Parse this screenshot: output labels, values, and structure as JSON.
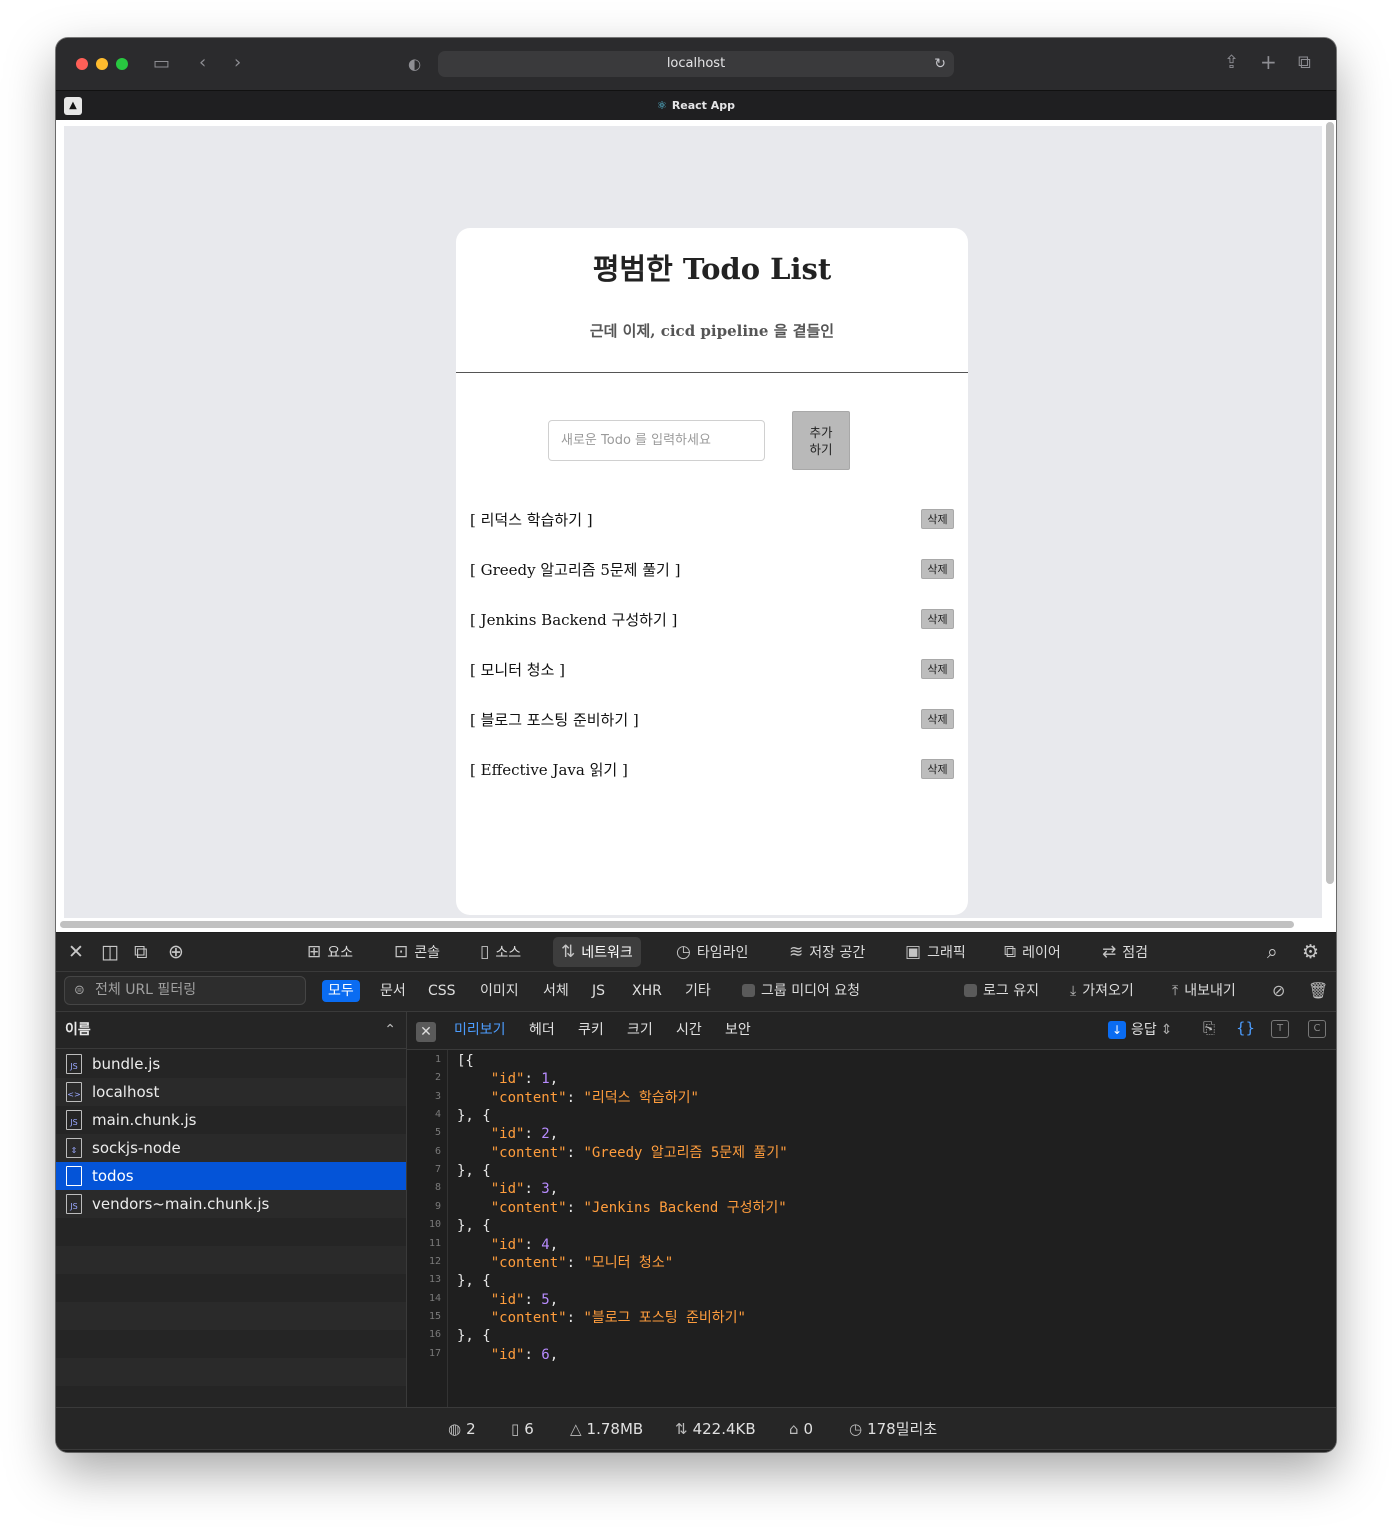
{
  "browser": {
    "url": "localhost",
    "tab_title": "React App",
    "colors": {
      "close": "#fe5f57",
      "minimize": "#febc2e",
      "zoom": "#28c840"
    }
  },
  "app": {
    "title": "평범한 Todo List",
    "subtitle": "근데 이제, cicd pipeline 을 곁들인",
    "input_placeholder": "새로운 Todo 를 입력하세요",
    "add_button": "추가\n하기",
    "delete_label": "삭제",
    "todos": [
      "[ 리덕스 학습하기 ]",
      "[ Greedy 알고리즘 5문제 풀기 ]",
      "[ Jenkins Backend 구성하기 ]",
      "[ 모니터 청소 ]",
      "[ 블로그 포스팅 준비하기 ]",
      "[ Effective Java 읽기 ]"
    ]
  },
  "devtools": {
    "tabs": [
      "요소",
      "콘솔",
      "소스",
      "네트워크",
      "타임라인",
      "저장 공간",
      "그래픽",
      "레이어",
      "점검"
    ],
    "active_tab": "네트워크",
    "filter_placeholder": "전체 URL 필터링",
    "types": [
      "모두",
      "문서",
      "CSS",
      "이미지",
      "서체",
      "JS",
      "XHR",
      "기타"
    ],
    "active_type": "모두",
    "group_media": "그룹 미디어 요청",
    "preserve_log": "로그 유지",
    "import": "가져오기",
    "export": "내보내기",
    "name_header": "이름",
    "resources": [
      {
        "name": "bundle.js",
        "type": "JS"
      },
      {
        "name": "localhost",
        "type": "<>"
      },
      {
        "name": "main.chunk.js",
        "type": "JS"
      },
      {
        "name": "sockjs-node",
        "type": "⇕"
      },
      {
        "name": "todos",
        "type": ""
      },
      {
        "name": "vendors~main.chunk.js",
        "type": "JS"
      }
    ],
    "selected_resource": "todos",
    "preview_tabs": [
      "미리보기",
      "헤더",
      "쿠키",
      "크기",
      "시간",
      "보안"
    ],
    "active_preview_tab": "미리보기",
    "response_label": "응답",
    "json_lines": [
      "[{",
      "    \"id\": 1,",
      "    \"content\": \"리덕스 학습하기\"",
      "}, {",
      "    \"id\": 2,",
      "    \"content\": \"Greedy 알고리즘 5문제 풀기\"",
      "}, {",
      "    \"id\": 3,",
      "    \"content\": \"Jenkins Backend 구성하기\"",
      "}, {",
      "    \"id\": 4,",
      "    \"content\": \"모니터 청소\"",
      "}, {",
      "    \"id\": 5,",
      "    \"content\": \"블로그 포스팅 준비하기\"",
      "}, {",
      "    \"id\": 6,"
    ],
    "status": {
      "requests": "2",
      "resources": "6",
      "transferred": "1.78MB",
      "size": "422.4KB",
      "errors": "0",
      "time": "178밀리초"
    }
  }
}
